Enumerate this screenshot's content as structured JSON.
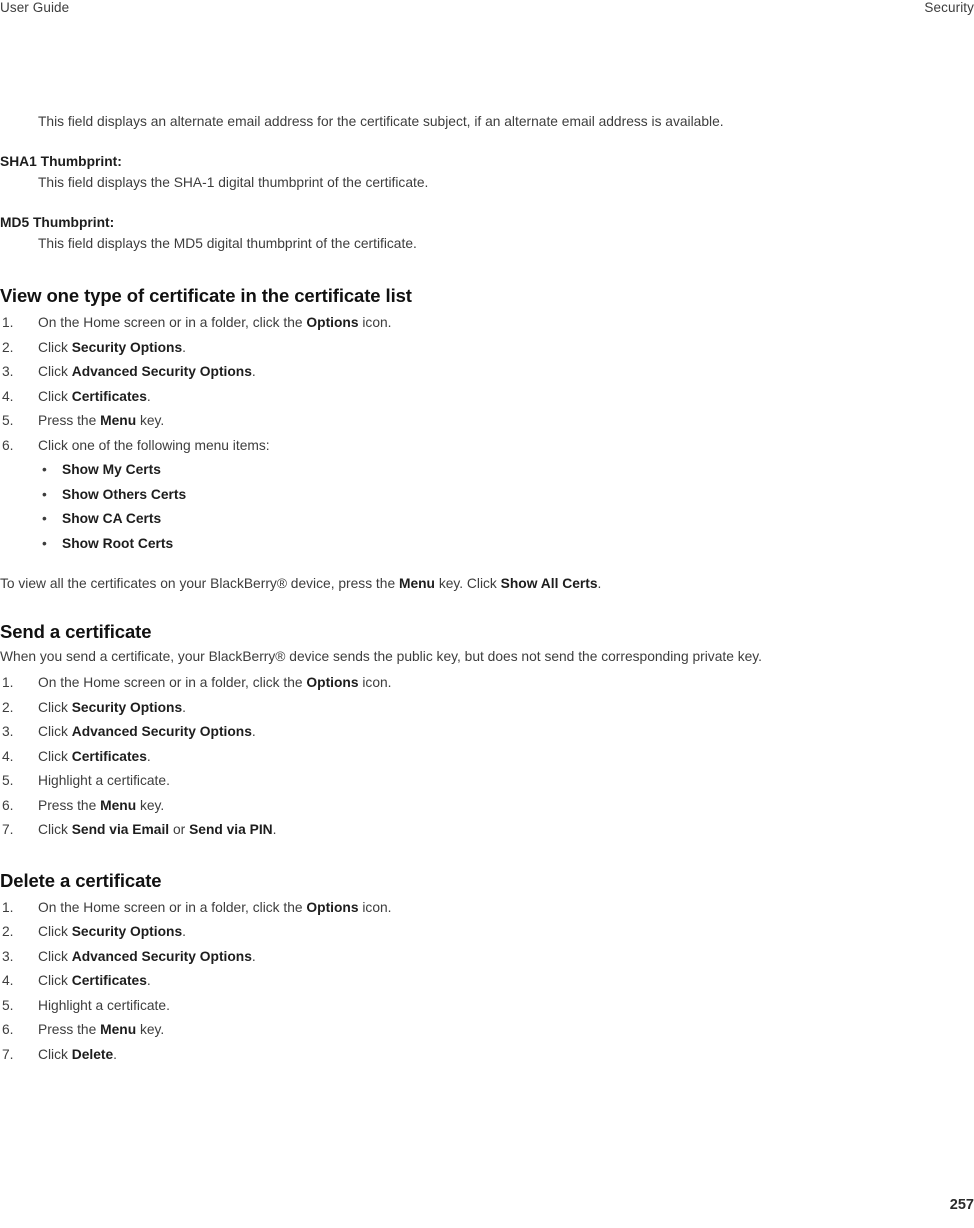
{
  "header": {
    "left": "User Guide",
    "right": "Security"
  },
  "footer": {
    "page_number": "257"
  },
  "intro": {
    "alternate_email_desc": "This field displays an alternate email address for the certificate subject, if an alternate email address is available.",
    "terms": [
      {
        "term": "SHA1 Thumbprint:",
        "desc": "This field displays the SHA-1 digital thumbprint of the certificate."
      },
      {
        "term": "MD5 Thumbprint:",
        "desc": "This field displays the MD5 digital thumbprint of the certificate."
      }
    ]
  },
  "sections": [
    {
      "heading": "View one type of certificate in the certificate list",
      "steps": [
        {
          "num": "1.",
          "pre": "On the Home screen or in a folder, click the ",
          "bold": "Options",
          "post": " icon."
        },
        {
          "num": "2.",
          "pre": "Click ",
          "bold": "Security Options",
          "post": "."
        },
        {
          "num": "3.",
          "pre": "Click ",
          "bold": "Advanced Security Options",
          "post": "."
        },
        {
          "num": "4.",
          "pre": "Click ",
          "bold": "Certificates",
          "post": "."
        },
        {
          "num": "5.",
          "pre": "Press the ",
          "bold": "Menu",
          "post": " key."
        },
        {
          "num": "6.",
          "pre": "Click one of the following menu items:",
          "bold": "",
          "post": ""
        }
      ],
      "bullets": [
        "Show My Certs",
        "Show Others Certs",
        "Show CA Certs",
        "Show Root Certs"
      ],
      "note": {
        "part1": "To view all the certificates on your BlackBerry® device, press the ",
        "bold1": "Menu",
        "part2": " key. Click ",
        "bold2": "Show All Certs",
        "part3": "."
      }
    },
    {
      "heading": "Send a certificate",
      "intro": "When you send a certificate, your BlackBerry® device sends the public key, but does not send the corresponding private key.",
      "steps": [
        {
          "num": "1.",
          "pre": "On the Home screen or in a folder, click the ",
          "bold": "Options",
          "post": " icon."
        },
        {
          "num": "2.",
          "pre": "Click ",
          "bold": "Security Options",
          "post": "."
        },
        {
          "num": "3.",
          "pre": "Click ",
          "bold": "Advanced Security Options",
          "post": "."
        },
        {
          "num": "4.",
          "pre": "Click ",
          "bold": "Certificates",
          "post": "."
        },
        {
          "num": "5.",
          "pre": "Highlight a certificate.",
          "bold": "",
          "post": ""
        },
        {
          "num": "6.",
          "pre": "Press the ",
          "bold": "Menu",
          "post": " key."
        },
        {
          "num": "7.",
          "pre": "Click ",
          "bold": "Send via Email",
          "post": " or ",
          "bold2": "Send via PIN",
          "post2": "."
        }
      ]
    },
    {
      "heading": "Delete a certificate",
      "steps": [
        {
          "num": "1.",
          "pre": "On the Home screen or in a folder, click the ",
          "bold": "Options",
          "post": " icon."
        },
        {
          "num": "2.",
          "pre": "Click ",
          "bold": "Security Options",
          "post": "."
        },
        {
          "num": "3.",
          "pre": "Click ",
          "bold": "Advanced Security Options",
          "post": "."
        },
        {
          "num": "4.",
          "pre": "Click ",
          "bold": "Certificates",
          "post": "."
        },
        {
          "num": "5.",
          "pre": "Highlight a certificate.",
          "bold": "",
          "post": ""
        },
        {
          "num": "6.",
          "pre": "Press the ",
          "bold": "Menu",
          "post": " key."
        },
        {
          "num": "7.",
          "pre": "Click ",
          "bold": "Delete",
          "post": "."
        }
      ]
    }
  ]
}
